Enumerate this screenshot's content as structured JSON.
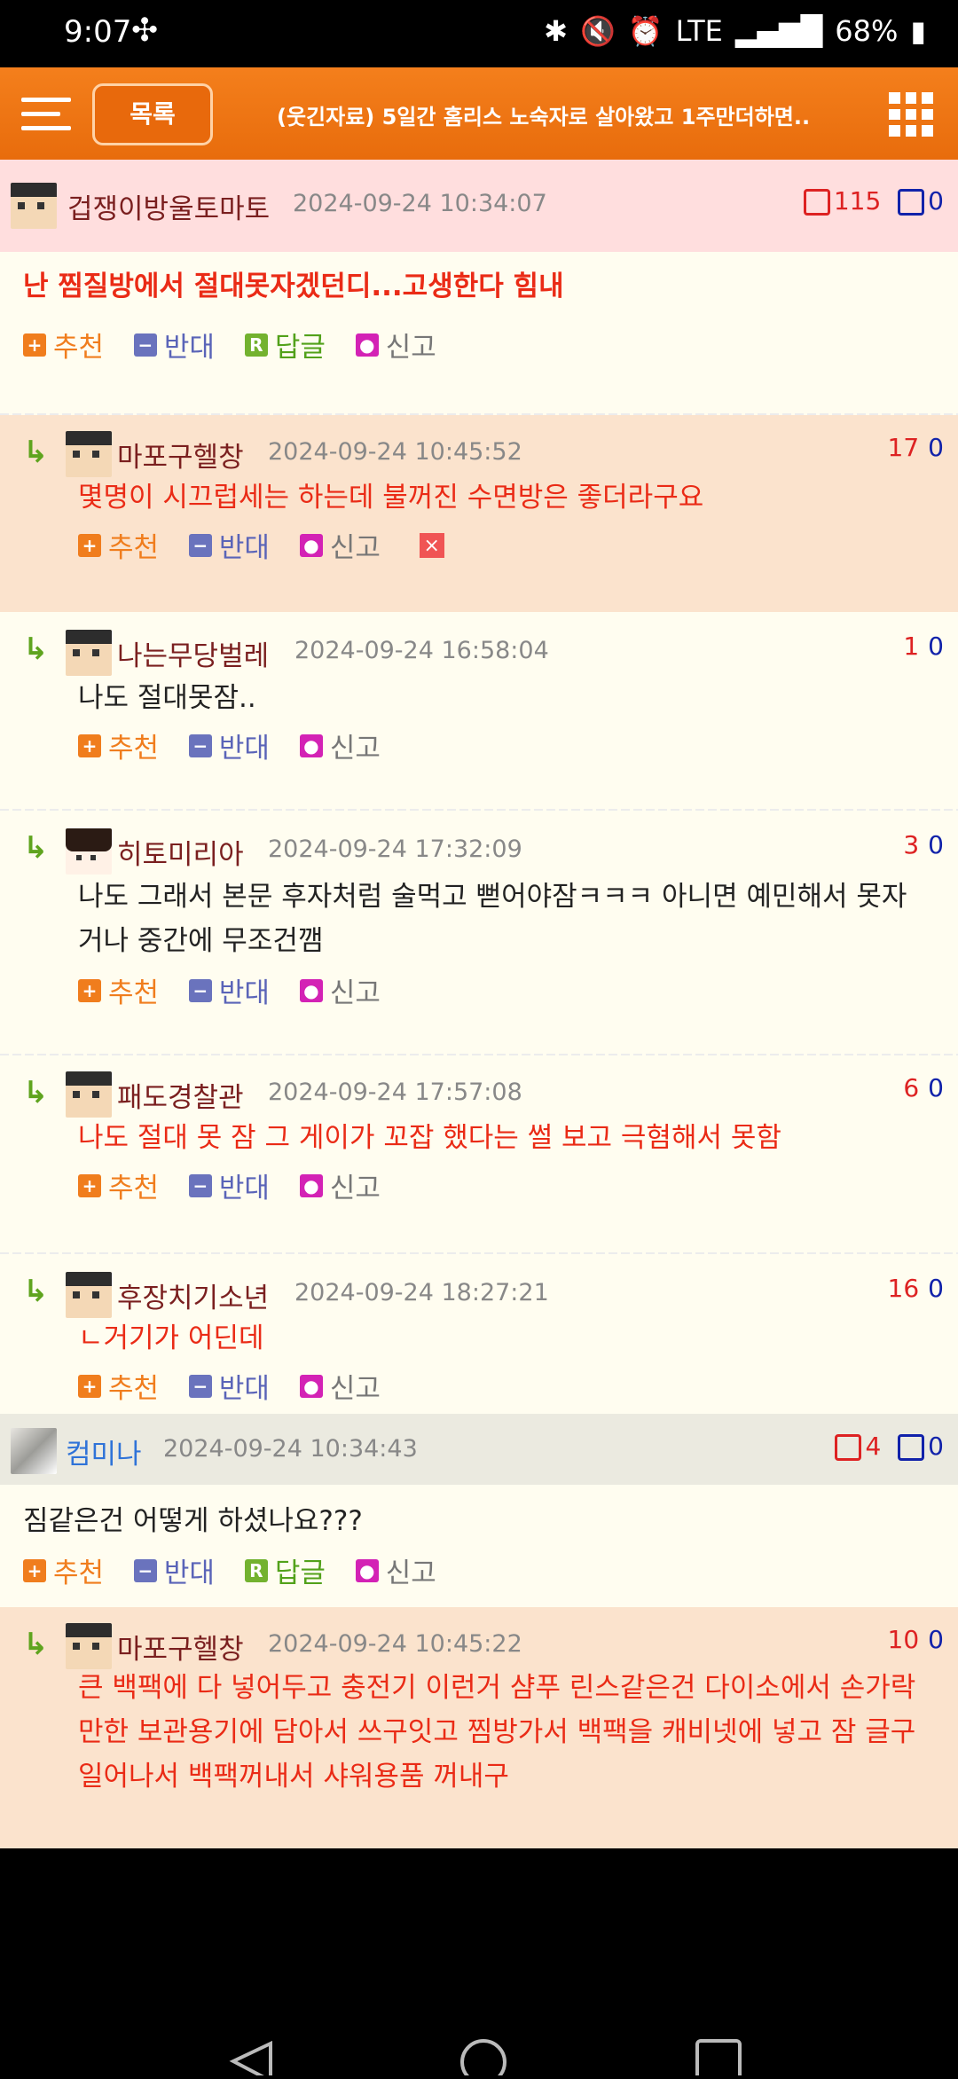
{
  "status_bar": {
    "time": "9:07",
    "battery": "68%"
  },
  "header": {
    "menu_label": "",
    "list_button": "목록",
    "title": "(웃긴자료) 5일간 홈리스 노숙자로 살아왔고 1주만더하면.."
  },
  "comments": [
    {
      "type": "main",
      "nickname": "겁쟁이방울토마토",
      "date": "2024-09-24 10:34:07",
      "up": "115",
      "down": "0",
      "text": "난 찜질방에서 절대못자겠던디...고생한다 힘내",
      "actions": [
        "추천",
        "반대",
        "답글",
        "신고"
      ]
    },
    {
      "type": "reply",
      "nickname": "마포구헬창",
      "date": "2024-09-24 10:45:52",
      "up": "17",
      "down": "0",
      "text": "몇명이 시끄럽세는 하는데 불꺼진 수면방은 좋더라구요",
      "actions": [
        "추천",
        "반대",
        "신고"
      ]
    },
    {
      "type": "reply",
      "nickname": "나는무당벌레",
      "date": "2024-09-24 16:58:04",
      "up": "1",
      "down": "0",
      "text": "나도 절대못잠..",
      "actions": [
        "추천",
        "반대",
        "신고"
      ]
    },
    {
      "type": "reply",
      "nickname": "히토미리아",
      "date": "2024-09-24 17:32:09",
      "up": "3",
      "down": "0",
      "text": "나도 그래서 본문 후자처럼 술먹고 뻗어야잠ㅋㅋㅋ 아니면 예민해서 못자거나 중간에 무조건깸",
      "actions": [
        "추천",
        "반대",
        "신고"
      ]
    },
    {
      "type": "reply",
      "nickname": "패도경찰관",
      "date": "2024-09-24 17:57:08",
      "up": "6",
      "down": "0",
      "text": "나도 절대 못 잠 그 게이가 꼬잡 했다는 썰 보고 극혐해서 못함",
      "actions": [
        "추천",
        "반대",
        "신고"
      ]
    },
    {
      "type": "reply",
      "nickname": "후장치기소년",
      "date": "2024-09-24 18:27:21",
      "up": "16",
      "down": "0",
      "text": "ㄴ거기가 어딘데",
      "actions": [
        "추천",
        "반대",
        "신고"
      ]
    },
    {
      "type": "main",
      "nickname": "컴미나",
      "date": "2024-09-24 10:34:43",
      "up": "4",
      "down": "0",
      "text": "짐같은건 어떻게 하셨나요???",
      "actions": [
        "추천",
        "반대",
        "답글",
        "신고"
      ]
    },
    {
      "type": "reply",
      "nickname": "마포구헬창",
      "date": "2024-09-24 10:45:22",
      "up": "10",
      "down": "0",
      "text": "큰 백팩에 다 넣어두고 충전기 이런거 샴푸 린스같은건 다이소에서 손가락만한 보관용기에 담아서 쓰구잇고 찜방가서 백팩을 캐비넷에 넣고 잠 글구 일어나서 백팩꺼내서 샤워용품 꺼내구",
      "actions": [
        "추천",
        "반대",
        "신고"
      ]
    }
  ]
}
